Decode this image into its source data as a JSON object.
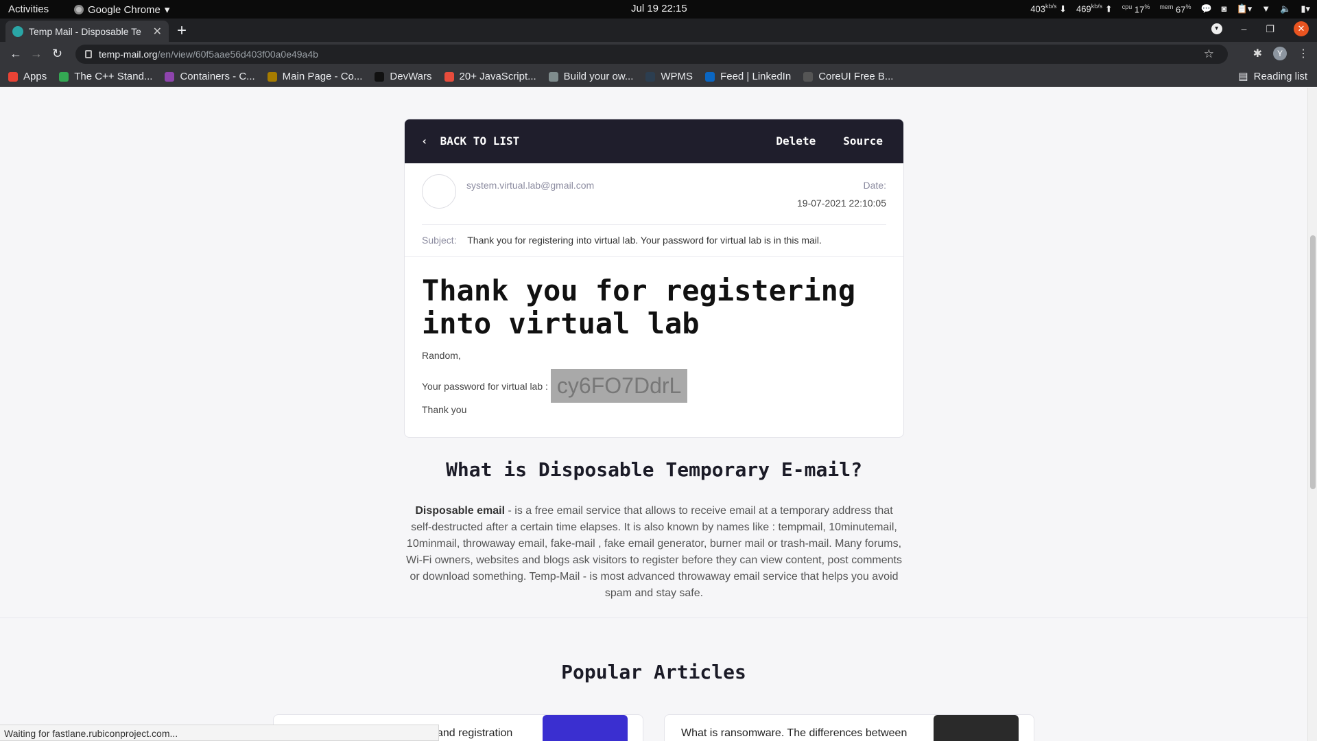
{
  "system": {
    "activities": "Activities",
    "app_name": "Google Chrome",
    "clock": "Jul 19  22:15",
    "net_down": "403",
    "net_up": "469",
    "net_unit": "kb/s",
    "cpu_label": "cpu",
    "cpu": "17",
    "mem_label": "mem",
    "mem": "67",
    "percent": "%"
  },
  "browser": {
    "tab_title": "Temp Mail - Disposable Te",
    "url_host": "temp-mail.org",
    "url_path": "/en/view/60f5aae56d403f00a0e49a4b",
    "profile_initial": "Y",
    "status_text": "Waiting for fastlane.rubiconproject.com..."
  },
  "bookmarks": [
    {
      "label": "Apps",
      "color": "#ea4335"
    },
    {
      "label": "The C++ Stand...",
      "color": "#34a853"
    },
    {
      "label": "Containers - C...",
      "color": "#8e44ad"
    },
    {
      "label": "Main Page - Co...",
      "color": "#a67c00"
    },
    {
      "label": "DevWars",
      "color": "#111111"
    },
    {
      "label": "20+ JavaScript...",
      "color": "#e74c3c"
    },
    {
      "label": "Build your ow...",
      "color": "#7f8c8d"
    },
    {
      "label": "WPMS",
      "color": "#2c3e50"
    },
    {
      "label": "Feed | LinkedIn",
      "color": "#0a66c2"
    },
    {
      "label": "CoreUI Free B...",
      "color": "#555555"
    }
  ],
  "reading_list": "Reading list",
  "mail": {
    "back_label": "BACK TO LIST",
    "delete_label": "Delete",
    "source_label": "Source",
    "from": "system.virtual.lab@gmail.com",
    "date_label": "Date:",
    "date_value": "19-07-2021 22:10:05",
    "subject_label": "Subject:",
    "subject": "Thank you for registering into virtual lab. Your password for virtual lab is in this mail.",
    "heading": "Thank you for registering into virtual lab",
    "greeting": "Random,",
    "password_label": "Your password for virtual lab :",
    "password": "cy6FO7DdrL",
    "closing": "Thank you"
  },
  "about": {
    "heading": "What is Disposable Temporary E-mail?",
    "bold_lead": "Disposable email",
    "text": " - is a free email service that allows to receive email at a temporary address that self-destructed after a certain time elapses. It is also known by names like : tempmail, 10minutemail, 10minmail, throwaway email, fake-mail , fake email generator, burner mail or trash-mail. Many forums, Wi-Fi owners, websites and blogs ask visitors to register before they can view content, post comments or download something. Temp-Mail - is most advanced throwaway email service that helps you avoid spam and stay safe."
  },
  "popular": {
    "heading": "Popular Articles",
    "articles": [
      {
        "title": "and registration",
        "thumb_color": "#3a2fd0"
      },
      {
        "title": "What is ransomware. The differences between",
        "thumb_color": "#2a2a2a"
      }
    ]
  }
}
